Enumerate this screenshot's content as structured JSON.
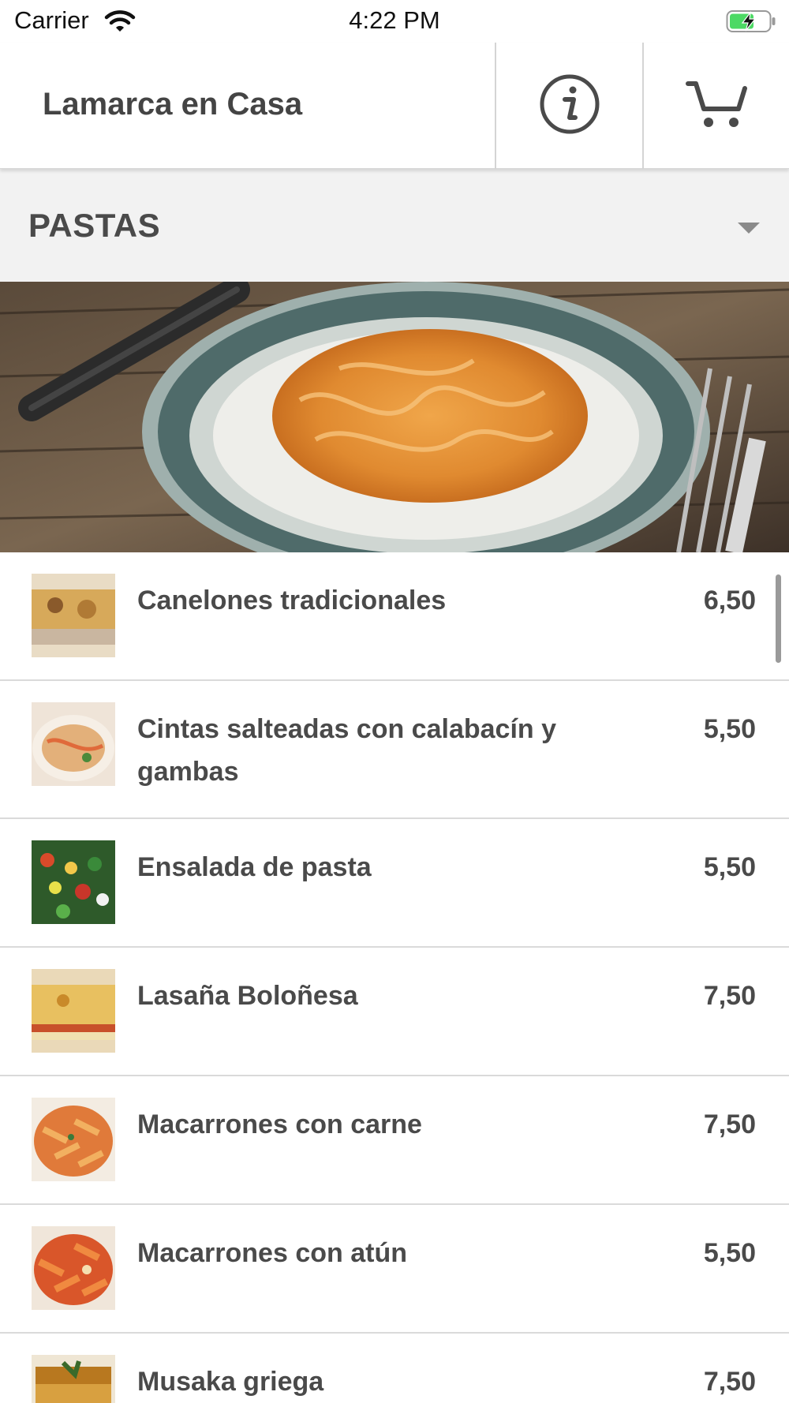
{
  "status_bar": {
    "carrier": "Carrier",
    "time": "4:22 PM",
    "wifi_icon": "wifi-icon",
    "battery_icon": "battery-charging-icon"
  },
  "nav": {
    "title": "Lamarca en Casa",
    "info_icon": "info-icon",
    "cart_icon": "cart-icon"
  },
  "category": {
    "selected": "PASTAS",
    "dropdown_icon": "caret-down-icon"
  },
  "hero": {
    "image": "pasta-plate-photo"
  },
  "items": [
    {
      "name": "Canelones tradicionales",
      "price": "6,50",
      "thumb": "canelones-photo"
    },
    {
      "name": "Cintas salteadas con calabacín y gambas",
      "price": "5,50",
      "thumb": "cintas-photo"
    },
    {
      "name": "Ensalada de pasta",
      "price": "5,50",
      "thumb": "ensalada-photo"
    },
    {
      "name": "Lasaña Boloñesa",
      "price": "7,50",
      "thumb": "lasana-photo"
    },
    {
      "name": "Macarrones con carne",
      "price": "7,50",
      "thumb": "macarrones-carne-photo"
    },
    {
      "name": "Macarrones con atún",
      "price": "5,50",
      "thumb": "macarrones-atun-photo"
    },
    {
      "name": "Musaka griega",
      "price": "7,50",
      "thumb": "musaka-photo"
    }
  ],
  "colors": {
    "text": "#4a4a4a",
    "category_bg": "#f2f2f2",
    "divider": "#dadada",
    "battery_green": "#4cd964"
  }
}
